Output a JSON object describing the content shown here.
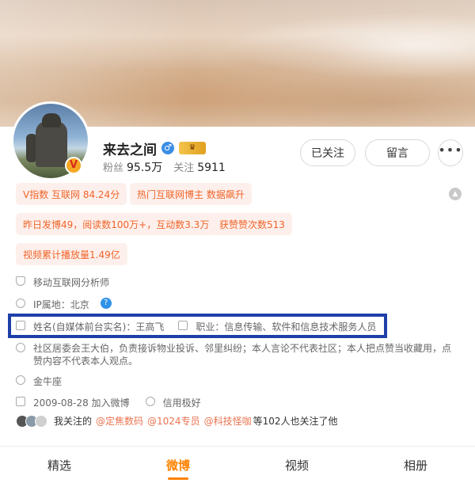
{
  "profile": {
    "name": "来去之间",
    "verified_badge": "V",
    "gender_icon": "male-icon",
    "fans_label": "粉丝",
    "fans_count": "95.5万",
    "following_label": "关注",
    "following_count": "5911"
  },
  "buttons": {
    "followed": "已关注",
    "message": "留言",
    "more": "•••"
  },
  "tags": [
    "V指数 互联网 84.24分",
    "热门互联网博主 数据飙升",
    "昨日发博49，阅读数100万+，互动数3.3万",
    "获赞赞次数513",
    "视频累计播放量1.49亿"
  ],
  "info": {
    "title": "移动互联网分析师",
    "ip_location": "IP属地：北京",
    "real_name": "姓名(自媒体前台实名)：王高飞",
    "occupation": "职业：信息传输、软件和信息技术服务人员",
    "community": "社区居委会王大伯，负责接诉物业投诉、邻里纠纷；本人言论不代表社区；本人把点赞当收藏用，点赞内容不代表本人观点。",
    "zodiac": "金牛座",
    "joined": "2009-08-28 加入微博",
    "credit": "信用极好"
  },
  "mutual_follow": {
    "prefix": "我关注的",
    "users": [
      "@定焦数码",
      "@1024专员",
      "@科技怪咖"
    ],
    "suffix": "等102人也关注了他"
  },
  "tabs": [
    "精选",
    "微博",
    "视频",
    "相册"
  ],
  "active_tab": "微博",
  "colors": {
    "accent": "#ff8200",
    "tag_text": "#f0642a",
    "tag_bg": "#fdf0ec",
    "highlight_border": "#1f3fa8"
  }
}
